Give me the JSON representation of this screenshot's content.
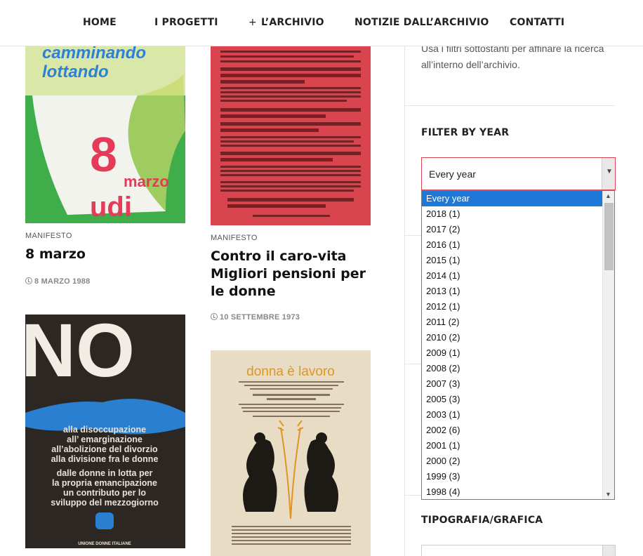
{
  "nav": [
    {
      "label": "HOME"
    },
    {
      "label": "I PROGETTI"
    },
    {
      "label": "L’ARCHIVIO",
      "prefix": "+"
    },
    {
      "label": "NOTIZIE DALL’ARCHIVIO"
    },
    {
      "label": "CONTATTI"
    }
  ],
  "posts": [
    {
      "category": "MANIFESTO",
      "title": "8 marzo",
      "date": "8 MARZO 1988",
      "poster": {
        "top_text": "camminando lottando",
        "big": "8",
        "small": "marzo",
        "brand": "udi",
        "bg": "#3fae4a"
      }
    },
    {
      "category": "MANIFESTO",
      "title_lines": [
        "Contro il caro-vita",
        "Migliori pensioni per",
        "le donne"
      ],
      "date": "10 SETTEMBRE 1973",
      "poster": {
        "bg": "#d9444e"
      }
    },
    {
      "poster": {
        "big": "NO",
        "lines": [
          "alla disoccupazione",
          "all’ emarginazione",
          "all’abolizione del divorzio",
          "alla divisione fra le donne"
        ],
        "lines2": [
          "dalle donne in lotta per",
          "la propria emancipazione",
          "un contributo per lo",
          "sviluppo del mezzogiorno"
        ],
        "footer": "UNIONE DONNE ITALIANE",
        "bg": "#2d2724"
      }
    },
    {
      "poster": {
        "title": "donna è lavoro",
        "sub": "IL COMITATO NAZIONALE PER LA PARITA",
        "motto": "PARITÀ DI TRATTAMENTO E EGUAGLIANZA",
        "bg": "#e9dcc4"
      }
    }
  ],
  "sidebar": {
    "intro": "Usa i filtri sottostanti per affinare la ricerca all’interno dell’archivio.",
    "filter_title": "FILTER BY YEAR",
    "selected": "Every year",
    "options": [
      "Every year",
      "2018 (1)",
      "2017 (2)",
      "2016 (1)",
      "2015 (1)",
      "2014 (1)",
      "2013 (1)",
      "2012 (1)",
      "2011 (2)",
      "2010 (2)",
      "2009 (1)",
      "2008 (2)",
      "2007 (3)",
      "2005 (3)",
      "2003 (1)",
      "2002 (6)",
      "2001 (1)",
      "2000 (2)",
      "1999 (3)",
      "1998 (4)"
    ],
    "second_title": "TIPOGRAFIA/GRAFICA"
  },
  "colors": {
    "accent": "#d94450",
    "highlight": "#1e78d7"
  }
}
